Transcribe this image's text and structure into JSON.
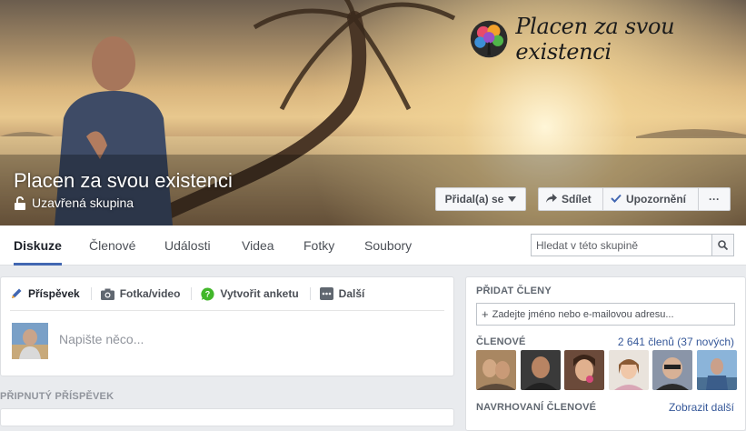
{
  "cover": {
    "brand_name": "Placen za svou existenci",
    "group_title": "Placen za svou existenci",
    "privacy_label": "Uzavřená skupina",
    "buttons": {
      "join": "Přidal(a) se",
      "share": "Sdílet",
      "notifications": "Upozornění",
      "more": "···"
    }
  },
  "tabs": [
    "Diskuze",
    "Členové",
    "Události",
    "Videa",
    "Fotky",
    "Soubory"
  ],
  "search": {
    "placeholder": "Hledat v této skupině"
  },
  "composer": {
    "tabs": [
      "Příspěvek",
      "Fotka/video",
      "Vytvořit anketu",
      "Další"
    ],
    "placeholder": "Napište něco..."
  },
  "pinned": {
    "heading": "PŘIPNUTÝ PŘÍSPĚVEK"
  },
  "sidebar": {
    "add_members_heading": "PŘIDAT ČLENY",
    "add_members_placeholder": "Zadejte jméno nebo e-mailovou adresu...",
    "members_heading": "ČLENOVÉ",
    "members_count": "2 641 členů (37 nových)",
    "suggested_heading": "NAVRHOVANÍ ČLENOVÉ",
    "show_more": "Zobrazit další"
  },
  "colors": {
    "accent": "#4267b2",
    "link": "#365899",
    "background": "#e9ebee"
  }
}
